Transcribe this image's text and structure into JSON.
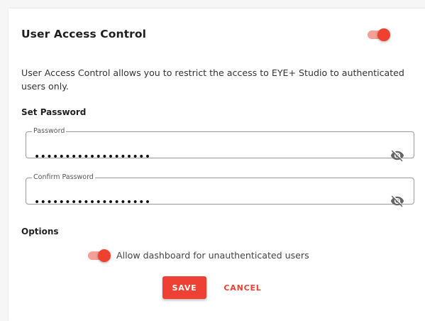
{
  "header": {
    "title": "User Access Control",
    "enabled": true
  },
  "description": "User Access Control allows you to restrict the access to EYE+ Studio to authenticated users only.",
  "password_section": {
    "label": "Set Password",
    "password": {
      "legend": "Password",
      "value": "•••••••••••••••••••"
    },
    "confirm": {
      "legend": "Confirm Password",
      "value": "•••••••••••••••••••"
    },
    "visibility_icon": "eye-off-icon"
  },
  "options_section": {
    "label": "Options",
    "dashboard_toggle": {
      "label": "Allow dashboard for unauthenticated users",
      "enabled": true
    }
  },
  "actions": {
    "save_label": "SAVE",
    "cancel_label": "CANCEL"
  },
  "colors": {
    "accent": "#ef4133",
    "toggle_track": "#f4a097",
    "border": "#9a9a9a"
  }
}
